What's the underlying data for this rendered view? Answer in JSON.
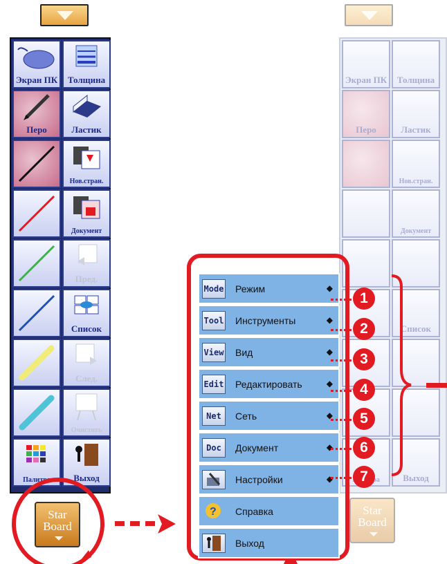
{
  "toolbar_left": {
    "cells": [
      {
        "label": "Экран ПК",
        "icon": "mouse-icon"
      },
      {
        "label": "Толщина",
        "icon": "line-width-icon"
      },
      {
        "label": "Перо",
        "icon": "pen-icon"
      },
      {
        "label": "Ластик",
        "icon": "eraser-icon"
      },
      {
        "label": "",
        "icon": "black-line-icon"
      },
      {
        "label": "Нов.стран.",
        "icon": "new-page-icon"
      },
      {
        "label": "",
        "icon": "red-line-icon"
      },
      {
        "label": "Документ",
        "icon": "document-icon"
      },
      {
        "label": "",
        "icon": "green-line-icon"
      },
      {
        "label": "Пред.",
        "icon": "previous-page-icon"
      },
      {
        "label": "",
        "icon": "blue-line-icon"
      },
      {
        "label": "Список",
        "icon": "page-list-icon"
      },
      {
        "label": "",
        "icon": "yellow-highlighter-icon"
      },
      {
        "label": "След.",
        "icon": "next-page-icon"
      },
      {
        "label": "",
        "icon": "cyan-highlighter-icon"
      },
      {
        "label": "Очистить",
        "icon": "clear-board-icon"
      },
      {
        "label": "Палитра",
        "icon": "palette-icon"
      },
      {
        "label": "Выход",
        "icon": "exit-door-icon"
      }
    ]
  },
  "starboard_button": {
    "line1": "Star",
    "line2": "Board"
  },
  "menu": {
    "items": [
      {
        "icon_text": "Mode",
        "label": "Режим",
        "arrow": "◆",
        "num": "1"
      },
      {
        "icon_text": "Tool",
        "label": "Инструменты",
        "arrow": "◆",
        "num": "2"
      },
      {
        "icon_text": "View",
        "label": "Вид",
        "arrow": "◆",
        "num": "3"
      },
      {
        "icon_text": "Edit",
        "label": "Редактировать",
        "arrow": "◆",
        "num": "4"
      },
      {
        "icon_text": "Net",
        "label": "Сеть",
        "arrow": "◆",
        "num": "5"
      },
      {
        "icon_text": "Doc",
        "label": "Документ",
        "arrow": "◆",
        "num": "6"
      },
      {
        "icon_text": "",
        "label": "Настройки",
        "arrow": "◆",
        "num": "7"
      },
      {
        "icon_text": "",
        "label": "Справка",
        "arrow": "",
        "num": ""
      },
      {
        "icon_text": "",
        "label": "Выход",
        "arrow": "",
        "num": ""
      }
    ]
  },
  "colors": {
    "accent": "#e21b23",
    "menu_bg": "#7fb2e5",
    "toolbar_label": "#1e2a86"
  }
}
